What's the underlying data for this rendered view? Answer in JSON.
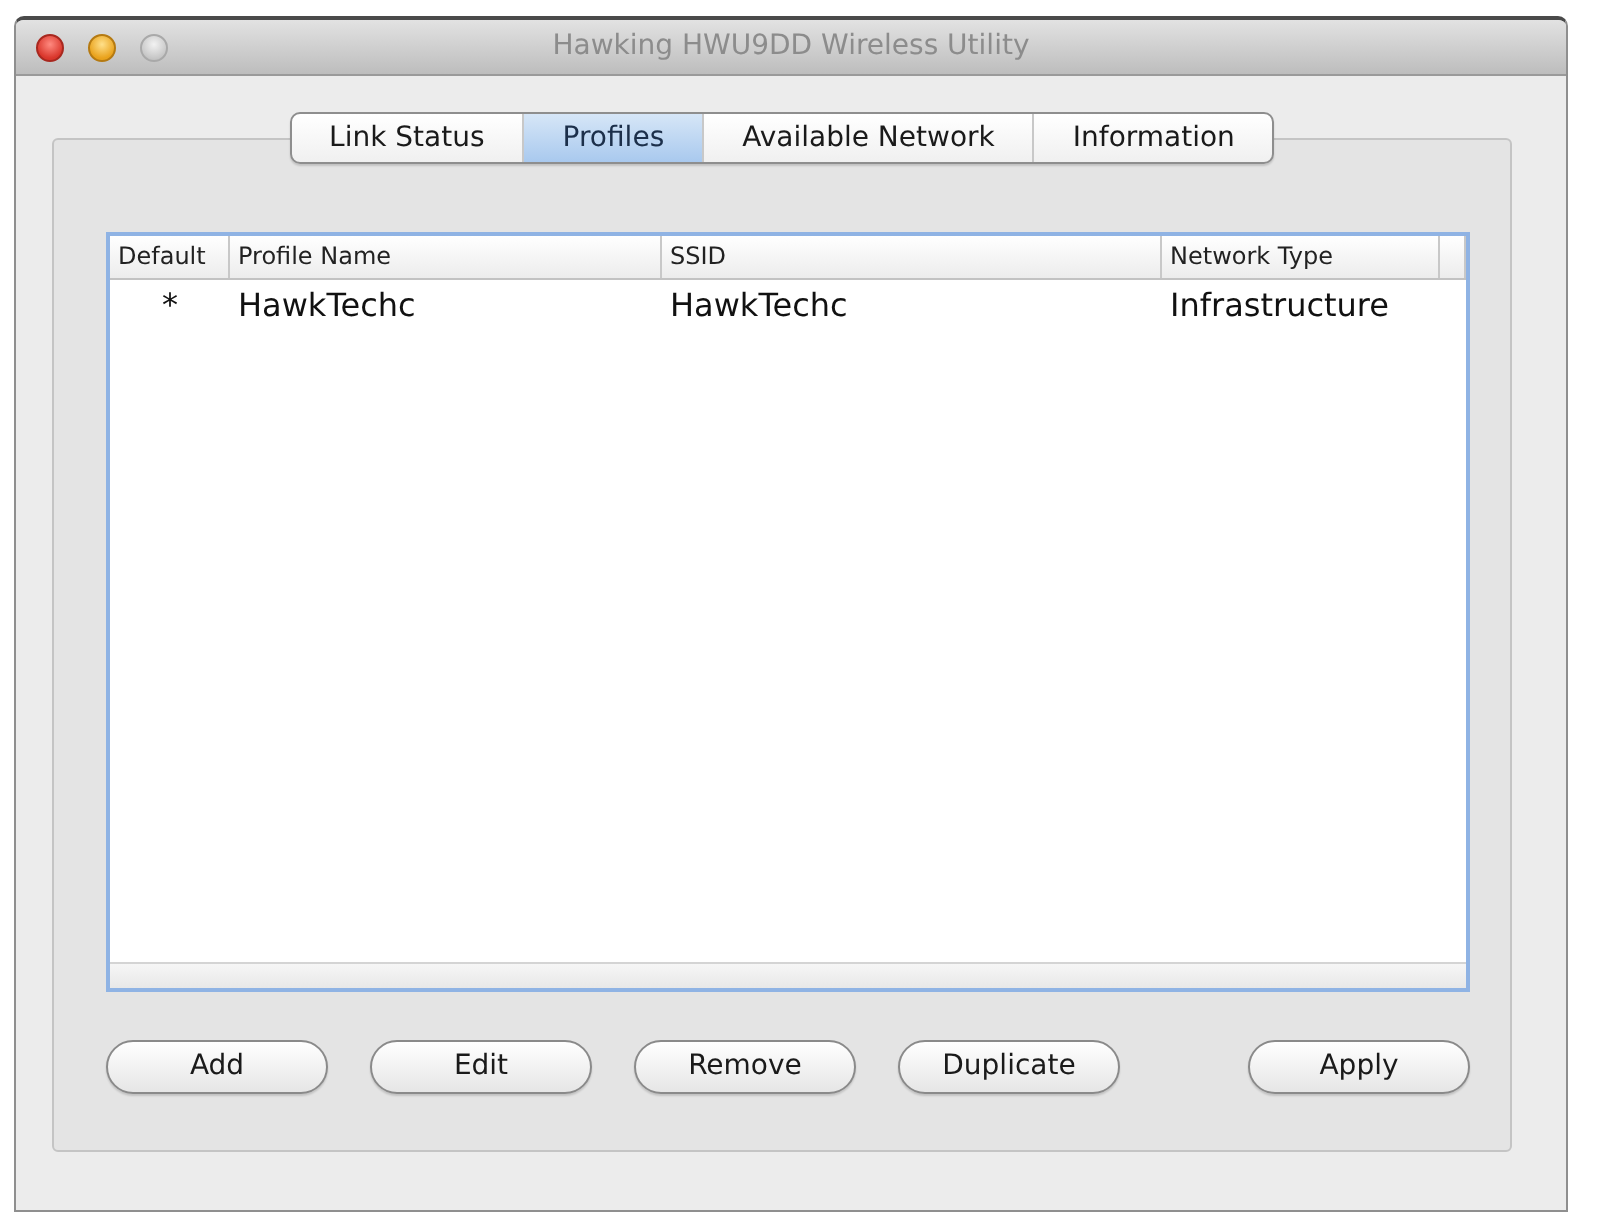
{
  "window": {
    "title": "Hawking HWU9DD Wireless Utility",
    "buttons": [
      {
        "kind": "close",
        "disabled": false
      },
      {
        "kind": "minimize",
        "disabled": false
      },
      {
        "kind": "zoom",
        "disabled": true
      }
    ]
  },
  "tabs": [
    {
      "label": "Link Status",
      "selected": false
    },
    {
      "label": "Profiles",
      "selected": true
    },
    {
      "label": "Available Network",
      "selected": false
    },
    {
      "label": "Information",
      "selected": false
    }
  ],
  "table": {
    "columns": [
      "Default",
      "Profile Name",
      "SSID",
      "Network Type"
    ],
    "rows": [
      {
        "selected": false,
        "cells": [
          "*",
          "HawkTechc",
          "HawkTechc",
          "Infrastructure"
        ]
      }
    ]
  },
  "buttons": [
    "Add",
    "Edit",
    "Remove",
    "Duplicate"
  ],
  "confirm_button": "Apply"
}
